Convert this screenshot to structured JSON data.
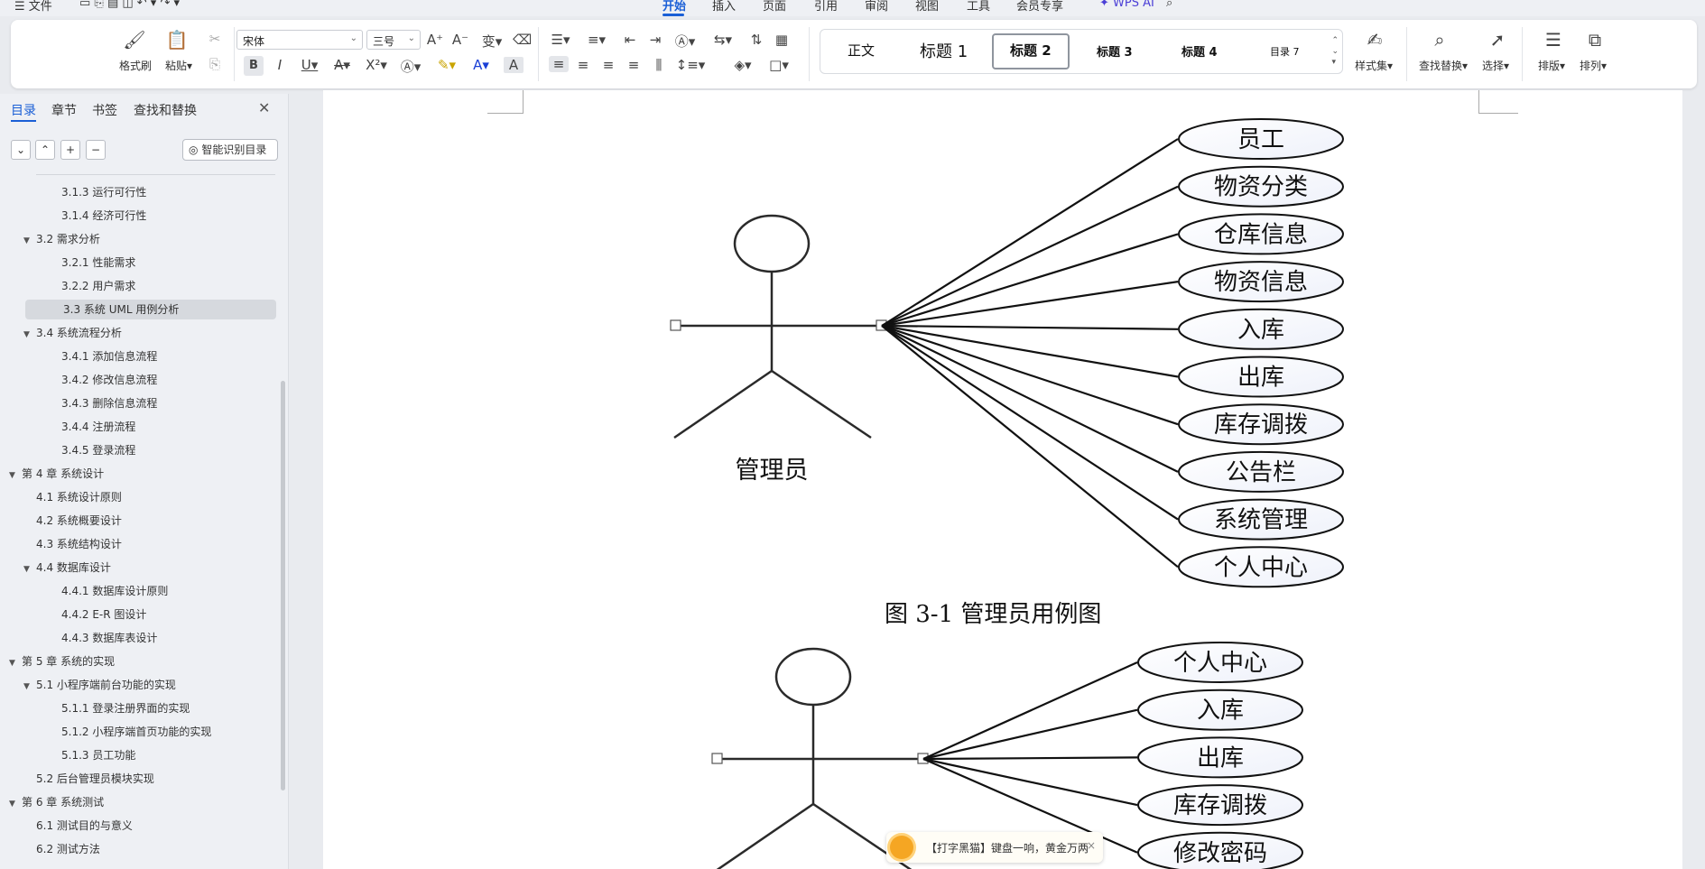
{
  "menu": {
    "file": "☰ 文件",
    "tabs": [
      "开始",
      "插入",
      "页面",
      "引用",
      "审阅",
      "视图",
      "工具",
      "会员专享"
    ],
    "active_tab": "开始",
    "wps_ai": "WPS AI"
  },
  "ribbon": {
    "format_painter": "格式刷",
    "paste": "粘贴",
    "font_name": "宋体",
    "font_size": "三号",
    "styles": [
      "正文",
      "标题 1",
      "标题 2",
      "标题 3",
      "标题 4",
      "目录 7"
    ],
    "selected_style": "标题 2",
    "style_set": "样式集",
    "find_replace": "查找替换",
    "select": "选择",
    "layout": "排版",
    "arrange": "排列"
  },
  "nav": {
    "tabs": [
      "目录",
      "章节",
      "书签",
      "查找和替换"
    ],
    "active_tab": "目录",
    "smart_toc": "智能识别目录",
    "items": [
      {
        "label": "3.1.3 运行可行性",
        "level": 3,
        "arrow": ""
      },
      {
        "label": "3.1.4 经济可行性",
        "level": 3,
        "arrow": ""
      },
      {
        "label": "3.2 需求分析",
        "level": 2,
        "arrow": "▼"
      },
      {
        "label": "3.2.1 性能需求",
        "level": 3,
        "arrow": ""
      },
      {
        "label": "3.2.2 用户需求",
        "level": 3,
        "arrow": ""
      },
      {
        "label": "3.3 系统 UML 用例分析",
        "level": 2,
        "arrow": "",
        "selected": true
      },
      {
        "label": "3.4 系统流程分析",
        "level": 2,
        "arrow": "▼"
      },
      {
        "label": "3.4.1 添加信息流程",
        "level": 3,
        "arrow": ""
      },
      {
        "label": "3.4.2 修改信息流程",
        "level": 3,
        "arrow": ""
      },
      {
        "label": "3.4.3 删除信息流程",
        "level": 3,
        "arrow": ""
      },
      {
        "label": "3.4.4 注册流程",
        "level": 3,
        "arrow": ""
      },
      {
        "label": "3.4.5 登录流程",
        "level": 3,
        "arrow": ""
      },
      {
        "label": "第 4 章 系统设计",
        "level": 1,
        "arrow": "▼"
      },
      {
        "label": "4.1 系统设计原则",
        "level": 2,
        "arrow": ""
      },
      {
        "label": "4.2 系统概要设计",
        "level": 2,
        "arrow": ""
      },
      {
        "label": "4.3 系统结构设计",
        "level": 2,
        "arrow": ""
      },
      {
        "label": "4.4 数据库设计",
        "level": 2,
        "arrow": "▼"
      },
      {
        "label": "4.4.1 数据库设计原则",
        "level": 3,
        "arrow": ""
      },
      {
        "label": "4.4.2 E-R 图设计",
        "level": 3,
        "arrow": ""
      },
      {
        "label": "4.4.3 数据库表设计",
        "level": 3,
        "arrow": ""
      },
      {
        "label": "第 5 章 系统的实现",
        "level": 1,
        "arrow": "▼"
      },
      {
        "label": "5.1 小程序端前台功能的实现",
        "level": 2,
        "arrow": "▼"
      },
      {
        "label": "5.1.1 登录注册界面的实现",
        "level": 3,
        "arrow": ""
      },
      {
        "label": "5.1.2 小程序端首页功能的实现",
        "level": 3,
        "arrow": ""
      },
      {
        "label": "5.1.3 员工功能",
        "level": 3,
        "arrow": ""
      },
      {
        "label": "5.2 后台管理员模块实现",
        "level": 2,
        "arrow": ""
      },
      {
        "label": "第 6 章 系统测试",
        "level": 1,
        "arrow": "▼"
      },
      {
        "label": "6.1 测试目的与意义",
        "level": 2,
        "arrow": ""
      },
      {
        "label": "6.2 测试方法",
        "level": 2,
        "arrow": ""
      }
    ]
  },
  "document": {
    "diagram1": {
      "actor": "管理员",
      "use_cases": [
        "员工",
        "物资分类",
        "仓库信息",
        "物资信息",
        "入库",
        "出库",
        "库存调拨",
        "公告栏",
        "系统管理",
        "个人中心"
      ]
    },
    "caption1": "图 3-1 管理员用例图",
    "diagram2": {
      "use_cases": [
        "个人中心",
        "入库",
        "出库",
        "库存调拨",
        "修改密码"
      ]
    }
  },
  "popup": {
    "text": "【打字黑猫】键盘一响，黄金万两",
    "close": "×"
  },
  "colors": {
    "accent": "#1a5fd6",
    "ellipse_fill": "#eef1fa"
  }
}
